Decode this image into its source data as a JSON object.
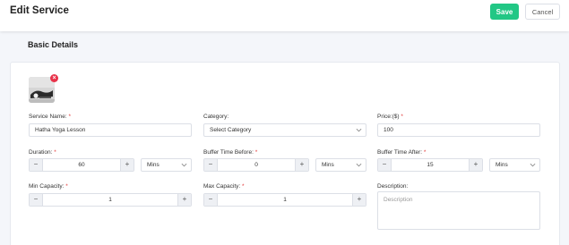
{
  "header": {
    "title": "Edit Service",
    "save_label": "Save",
    "cancel_label": "Cancel"
  },
  "section": {
    "title": "Basic Details"
  },
  "image": {
    "remove_icon": "×"
  },
  "fields": {
    "service_name": {
      "label": "Service Name:",
      "required": "*",
      "value": "Hatha Yoga Lesson"
    },
    "category": {
      "label": "Category:",
      "value": "Select Category"
    },
    "price": {
      "label": "Price:($)",
      "required": "*",
      "value": "100"
    },
    "duration": {
      "label": "Duration:",
      "required": "*",
      "value": "60",
      "unit": "Mins"
    },
    "buffer_before": {
      "label": "Buffer Time Before:",
      "required": "*",
      "value": "0",
      "unit": "Mins"
    },
    "buffer_after": {
      "label": "Buffer Time After:",
      "required": "*",
      "value": "15",
      "unit": "Mins"
    },
    "min_capacity": {
      "label": "Min Capacity:",
      "required": "*",
      "value": "1"
    },
    "max_capacity": {
      "label": "Max Capacity:",
      "required": "*",
      "value": "1"
    },
    "description": {
      "label": "Description:",
      "placeholder": "Description"
    }
  },
  "stepper": {
    "minus": "−",
    "plus": "+"
  },
  "colors": {
    "accent": "#22c785",
    "danger": "#e8334a",
    "required": "#e23b3b"
  }
}
